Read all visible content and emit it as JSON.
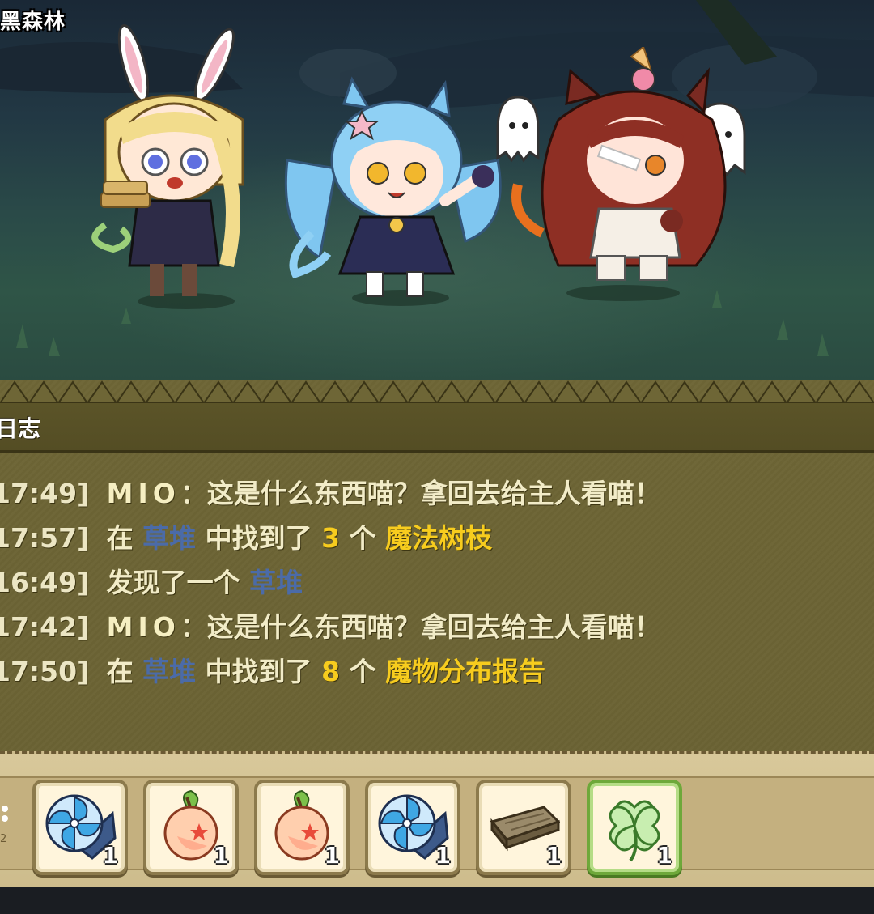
{
  "location": {
    "name": "黑森林"
  },
  "log": {
    "title": "日志",
    "entries": [
      {
        "time": "17:49]",
        "speaker": "MIO",
        "message": "这是什么东西喵？拿回去给主人看喵！"
      },
      {
        "time": "17:57]",
        "prefix": "在",
        "place": "草堆",
        "middle": "中找到了",
        "count": "3",
        "unit": "个",
        "item": "魔法树枝"
      },
      {
        "time": "16:49]",
        "prefix": "发现了一个",
        "place": "草堆"
      },
      {
        "time": "17:42]",
        "speaker": "MIO",
        "message": "这是什么东西喵？拿回去给主人看喵！"
      },
      {
        "time": "17:50]",
        "prefix": "在",
        "place": "草堆",
        "middle": "中找到了",
        "count": "8",
        "unit": "个",
        "item": "魔物分布报告"
      }
    ]
  },
  "inventory": {
    "page_indicator": "2",
    "slots": [
      {
        "icon": "blue-pinwheel-scroll-icon",
        "quantity": "1"
      },
      {
        "icon": "peach-icon",
        "quantity": "1"
      },
      {
        "icon": "peach-icon",
        "quantity": "1"
      },
      {
        "icon": "blue-pinwheel-scroll-icon",
        "quantity": "1"
      },
      {
        "icon": "wooden-plank-icon",
        "quantity": "1"
      },
      {
        "icon": "four-leaf-clover-icon",
        "quantity": "1",
        "selected": true
      }
    ]
  },
  "colors": {
    "place": "#4b6ba8",
    "item": "#f7cc1e",
    "log_text": "#f2ecc8",
    "panel": "#6e6636",
    "selected_slot": "#6ea83a"
  }
}
